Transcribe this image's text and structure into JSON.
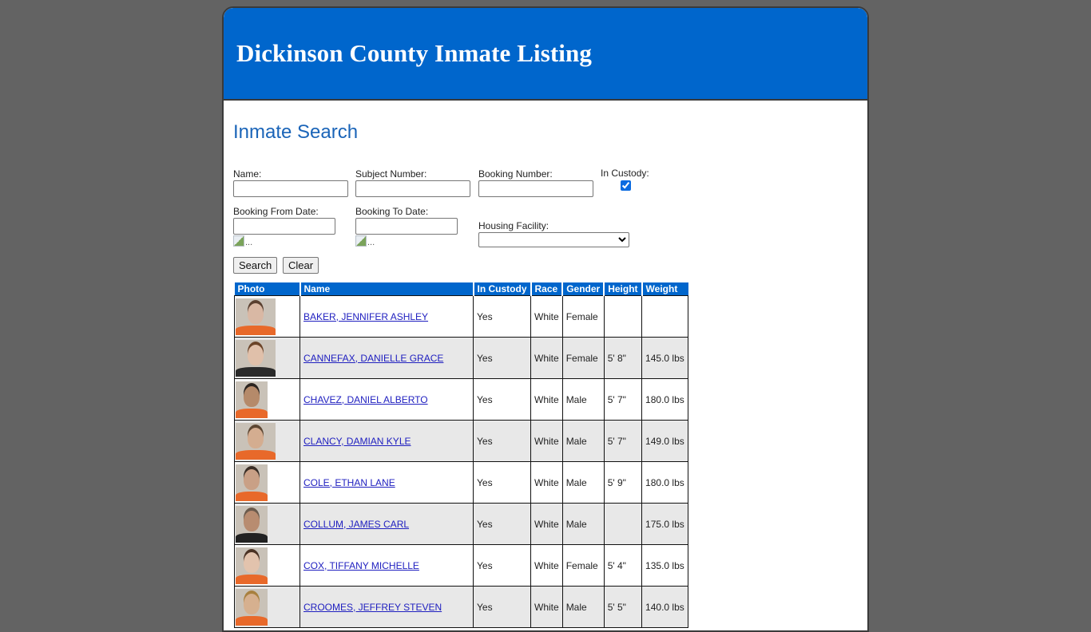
{
  "header": {
    "title": "Dickinson County Inmate Listing"
  },
  "search": {
    "title": "Inmate Search",
    "name_label": "Name:",
    "name_value": "",
    "subject_label": "Subject Number:",
    "subject_value": "",
    "booking_label": "Booking Number:",
    "booking_value": "",
    "custody_label": "In Custody:",
    "custody_checked": true,
    "from_date_label": "Booking From Date:",
    "from_date_value": "",
    "to_date_label": "Booking To Date:",
    "to_date_value": "",
    "calendar_icon_alt": "...",
    "facility_label": "Housing Facility:",
    "facility_selected": "",
    "search_button": "Search",
    "clear_button": "Clear"
  },
  "table": {
    "columns": [
      "Photo",
      "Name",
      "In Custody",
      "Race",
      "Gender",
      "Height",
      "Weight"
    ],
    "rows": [
      {
        "name": "BAKER, JENNIFER ASHLEY",
        "in_custody": "Yes",
        "race": "White",
        "gender": "Female",
        "height": "",
        "weight": ""
      },
      {
        "name": "CANNEFAX, DANIELLE GRACE",
        "in_custody": "Yes",
        "race": "White",
        "gender": "Female",
        "height": "5' 8\"",
        "weight": "145.0 lbs"
      },
      {
        "name": "CHAVEZ, DANIEL ALBERTO",
        "in_custody": "Yes",
        "race": "White",
        "gender": "Male",
        "height": "5' 7\"",
        "weight": "180.0 lbs"
      },
      {
        "name": "CLANCY, DAMIAN KYLE",
        "in_custody": "Yes",
        "race": "White",
        "gender": "Male",
        "height": "5' 7\"",
        "weight": "149.0 lbs"
      },
      {
        "name": "COLE, ETHAN LANE",
        "in_custody": "Yes",
        "race": "White",
        "gender": "Male",
        "height": "5' 9\"",
        "weight": "180.0 lbs"
      },
      {
        "name": "COLLUM, JAMES CARL",
        "in_custody": "Yes",
        "race": "White",
        "gender": "Male",
        "height": "",
        "weight": "175.0 lbs"
      },
      {
        "name": "COX, TIFFANY MICHELLE",
        "in_custody": "Yes",
        "race": "White",
        "gender": "Female",
        "height": "5' 4\"",
        "weight": "135.0 lbs"
      },
      {
        "name": "CROOMES, JEFFREY STEVEN",
        "in_custody": "Yes",
        "race": "White",
        "gender": "Male",
        "height": "5' 5\"",
        "weight": "140.0 lbs"
      }
    ]
  },
  "colors": {
    "brand_blue": "#0066cc",
    "title_blue": "#1a64b8",
    "background": "#636363",
    "alt_row": "#e8e8e8"
  }
}
